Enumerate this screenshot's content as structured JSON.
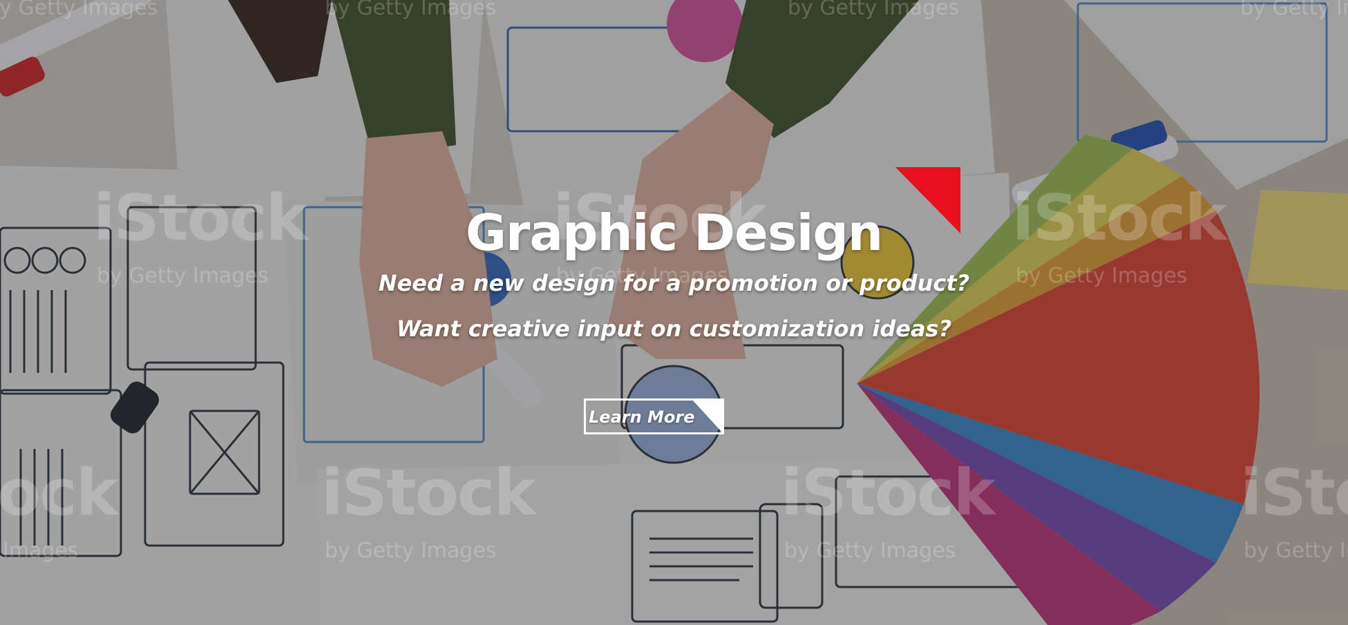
{
  "hero": {
    "title": "Graphic Design",
    "line_1": "Need a new design for a promotion or product?",
    "line_2": "Want creative input on customization ideas?",
    "cta_label": "Learn More"
  },
  "watermarks": {
    "brand": "iStock",
    "byline": "by Getty Images"
  },
  "colors": {
    "accent": "#e6101f",
    "text": "#ffffff"
  }
}
